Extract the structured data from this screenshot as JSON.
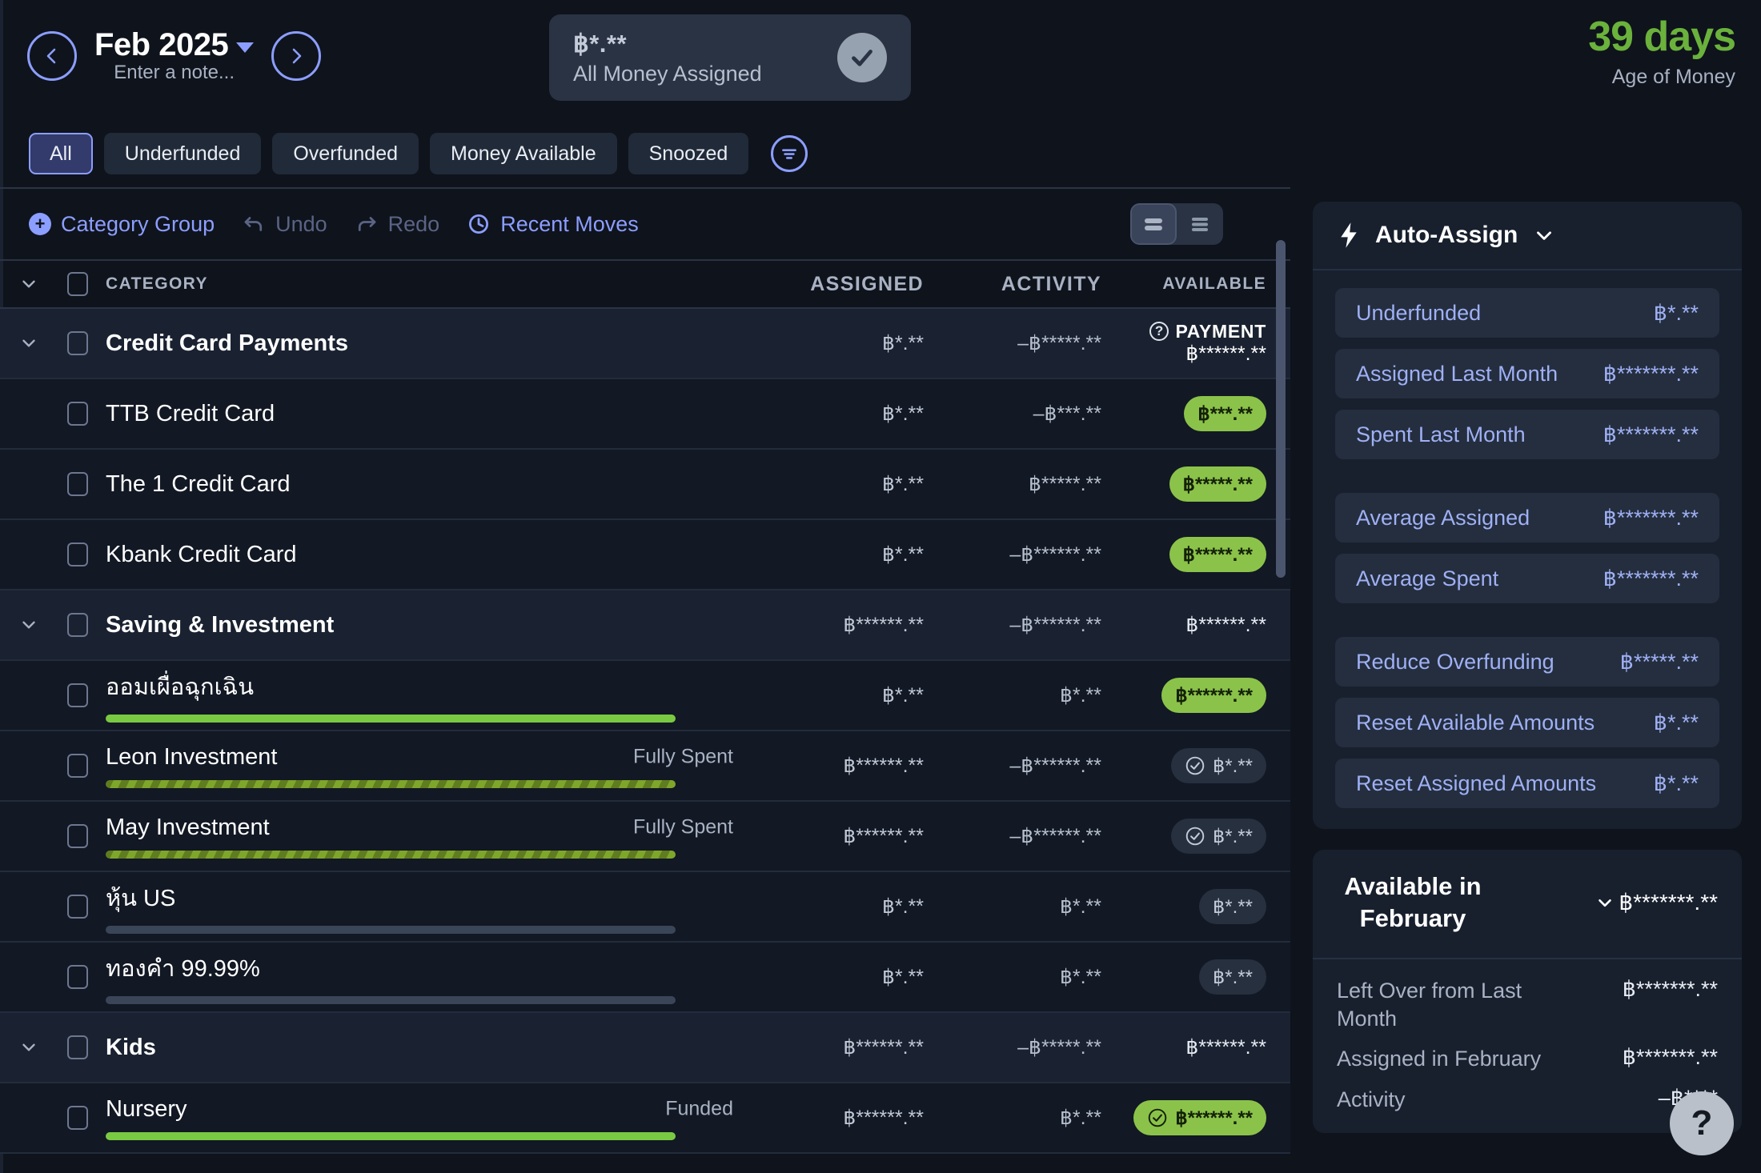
{
  "header": {
    "prev_button_icon": "chevron-left-icon",
    "next_button_icon": "chevron-right-icon",
    "month": "Feb 2025",
    "note_placeholder": "Enter a note...",
    "assigned_amount": "฿*.**",
    "assigned_label": "All Money Assigned",
    "assigned_status_icon": "check-circle-icon",
    "age_of_money_value": "39 days",
    "age_of_money_label": "Age of Money",
    "accent_green": "#6ab23c"
  },
  "filters": {
    "chips": [
      {
        "label": "All",
        "active": true
      },
      {
        "label": "Underfunded",
        "active": false
      },
      {
        "label": "Overfunded",
        "active": false
      },
      {
        "label": "Money Available",
        "active": false
      },
      {
        "label": "Snoozed",
        "active": false
      }
    ],
    "filter_icon": "filter-icon"
  },
  "toolbar": {
    "category_group": "Category Group",
    "undo": "Undo",
    "redo": "Redo",
    "recent_moves": "Recent Moves",
    "view_compact_icon": "view-compact-icon",
    "view_list_icon": "view-list-icon"
  },
  "table": {
    "columns": [
      "CATEGORY",
      "ASSIGNED",
      "ACTIVITY",
      "AVAILABLE"
    ],
    "rows": [
      {
        "type": "group",
        "name": "Credit Card Payments",
        "assigned": "฿*.**",
        "activity": "–฿*****.**",
        "available_kind": "payment",
        "payment_label": "PAYMENT",
        "available": "฿******.**"
      },
      {
        "type": "category",
        "name": "TTB Credit Card",
        "assigned": "฿*.**",
        "activity": "–฿***.**",
        "available_kind": "pill-green",
        "available": "฿***.**",
        "goal_tag": "",
        "progress": "none"
      },
      {
        "type": "category",
        "name": "The 1 Credit Card",
        "assigned": "฿*.**",
        "activity": "฿*****.**",
        "available_kind": "pill-green",
        "available": "฿*****.**",
        "goal_tag": "",
        "progress": "none"
      },
      {
        "type": "category",
        "name": "Kbank Credit Card",
        "assigned": "฿*.**",
        "activity": "–฿******.**",
        "available_kind": "pill-green",
        "available": "฿*****.**",
        "goal_tag": "",
        "progress": "none"
      },
      {
        "type": "group",
        "name": "Saving & Investment",
        "assigned": "฿******.**",
        "activity": "–฿******.**",
        "available_kind": "plain",
        "available": "฿******.**"
      },
      {
        "type": "category",
        "name": "ออมเผื่อฉุกเฉิน",
        "assigned": "฿*.**",
        "activity": "฿*.**",
        "available_kind": "pill-green",
        "available": "฿******.**",
        "goal_tag": "",
        "progress": "green"
      },
      {
        "type": "category",
        "name": "Leon Investment",
        "assigned": "฿******.**",
        "activity": "–฿******.**",
        "available_kind": "pill-gray-check",
        "available": "฿*.**",
        "goal_tag": "Fully Spent",
        "progress": "striped"
      },
      {
        "type": "category",
        "name": "May Investment",
        "assigned": "฿******.**",
        "activity": "–฿******.**",
        "available_kind": "pill-gray-check",
        "available": "฿*.**",
        "goal_tag": "Fully Spent",
        "progress": "striped"
      },
      {
        "type": "category",
        "name": "หุ้น US",
        "assigned": "฿*.**",
        "activity": "฿*.**",
        "available_kind": "pill-gray",
        "available": "฿*.**",
        "goal_tag": "",
        "progress": "gray"
      },
      {
        "type": "category",
        "name": "ทองคำ 99.99%",
        "assigned": "฿*.**",
        "activity": "฿*.**",
        "available_kind": "pill-gray",
        "available": "฿*.**",
        "goal_tag": "",
        "progress": "gray"
      },
      {
        "type": "group",
        "name": "Kids",
        "assigned": "฿******.**",
        "activity": "–฿*****.**",
        "available_kind": "plain",
        "available": "฿******.**"
      },
      {
        "type": "category",
        "name": "Nursery",
        "assigned": "฿******.**",
        "activity": "฿*.**",
        "available_kind": "pill-green-check",
        "available": "฿******.**",
        "goal_tag": "Funded",
        "progress": "green"
      }
    ]
  },
  "auto_assign": {
    "title": "Auto-Assign",
    "bolt_icon": "bolt-icon",
    "chevron_icon": "chevron-down-icon",
    "buttons": [
      {
        "label": "Underfunded",
        "value": "฿*.**"
      },
      {
        "label": "Assigned Last Month",
        "value": "฿*******.**"
      },
      {
        "label": "Spent Last Month",
        "value": "฿*******.**"
      },
      {
        "label": "Average Assigned",
        "value": "฿*******.**"
      },
      {
        "label": "Average Spent",
        "value": "฿*******.**"
      },
      {
        "label": "Reduce Overfunding",
        "value": "฿*****.**"
      },
      {
        "label": "Reset Available Amounts",
        "value": "฿*.**"
      },
      {
        "label": "Reset Assigned Amounts",
        "value": "฿*.**"
      }
    ]
  },
  "available_card": {
    "title": "Available in February",
    "chevron_icon": "chevron-down-icon",
    "total": "฿*******.**",
    "rows": [
      {
        "label": "Left Over from Last Month",
        "value": "฿*******.**"
      },
      {
        "label": "Assigned in February",
        "value": "฿*******.**"
      },
      {
        "label": "Activity",
        "value": "–฿****"
      }
    ]
  },
  "help": {
    "label": "?"
  }
}
